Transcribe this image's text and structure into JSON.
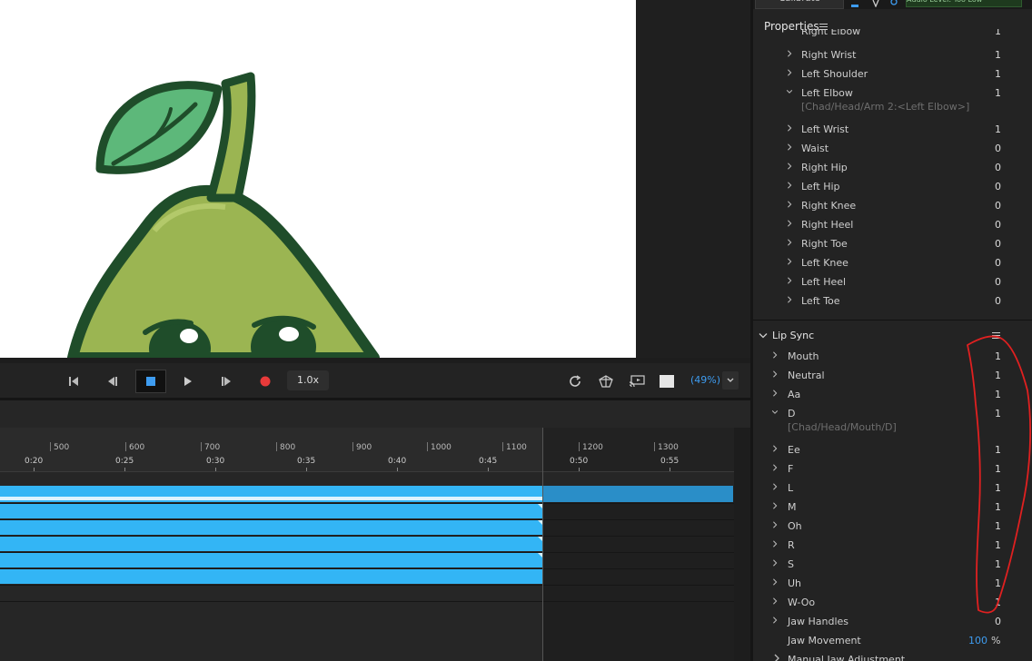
{
  "header": {
    "calibrate_label": "Calibrate",
    "audio_level_label": "Audio Level: Too Low"
  },
  "transport": {
    "speed": "1.0x",
    "zoom": "(49%)"
  },
  "timeline": {
    "frame_labels": [
      "500",
      "600",
      "700",
      "800",
      "900",
      "1000",
      "1100",
      "1200",
      "1300"
    ],
    "time_labels": [
      "0:20",
      "0:25",
      "0:30",
      "0:35",
      "0:40",
      "0:45",
      "0:50",
      "0:55"
    ]
  },
  "properties": {
    "title": "Properties",
    "cut_label": "Right Elbow",
    "rows": [
      {
        "label": "Right Wrist",
        "value": "1",
        "expanded": false
      },
      {
        "label": "Left Shoulder",
        "value": "1",
        "expanded": false
      },
      {
        "label": "Left Elbow",
        "value": "1",
        "expanded": true,
        "path": "[Chad/Head/Arm 2:<Left Elbow>]"
      },
      {
        "label": "Left Wrist",
        "value": "1",
        "expanded": false
      },
      {
        "label": "Waist",
        "value": "0",
        "expanded": false
      },
      {
        "label": "Right Hip",
        "value": "0",
        "expanded": false
      },
      {
        "label": "Left Hip",
        "value": "0",
        "expanded": false
      },
      {
        "label": "Right Knee",
        "value": "0",
        "expanded": false
      },
      {
        "label": "Right Heel",
        "value": "0",
        "expanded": false
      },
      {
        "label": "Right Toe",
        "value": "0",
        "expanded": false
      },
      {
        "label": "Left Knee",
        "value": "0",
        "expanded": false
      },
      {
        "label": "Left Heel",
        "value": "0",
        "expanded": false
      },
      {
        "label": "Left Toe",
        "value": "0",
        "expanded": false
      }
    ]
  },
  "lip_sync": {
    "title": "Lip Sync",
    "rows": [
      {
        "label": "Mouth",
        "value": "1"
      },
      {
        "label": "Neutral",
        "value": "1"
      },
      {
        "label": "Aa",
        "value": "1"
      },
      {
        "label": "D",
        "value": "1",
        "expanded": true,
        "path": "[Chad/Head/Mouth/D]"
      },
      {
        "label": "Ee",
        "value": "1"
      },
      {
        "label": "F",
        "value": "1"
      },
      {
        "label": "L",
        "value": "1"
      },
      {
        "label": "M",
        "value": "1"
      },
      {
        "label": "Oh",
        "value": "1"
      },
      {
        "label": "R",
        "value": "1"
      },
      {
        "label": "S",
        "value": "1"
      },
      {
        "label": "Uh",
        "value": "1"
      },
      {
        "label": "W-Oo",
        "value": "1"
      },
      {
        "label": "Jaw Handles",
        "value": "0"
      }
    ],
    "jaw_movement": {
      "label": "Jaw Movement",
      "value": "100",
      "unit": "%"
    },
    "manual_jaw": "Manual Jaw Adjustment"
  },
  "colors": {
    "accent": "#3e9cf0",
    "track": "#33b5f5",
    "annotation": "#e02020",
    "record": "#e83a3a"
  }
}
